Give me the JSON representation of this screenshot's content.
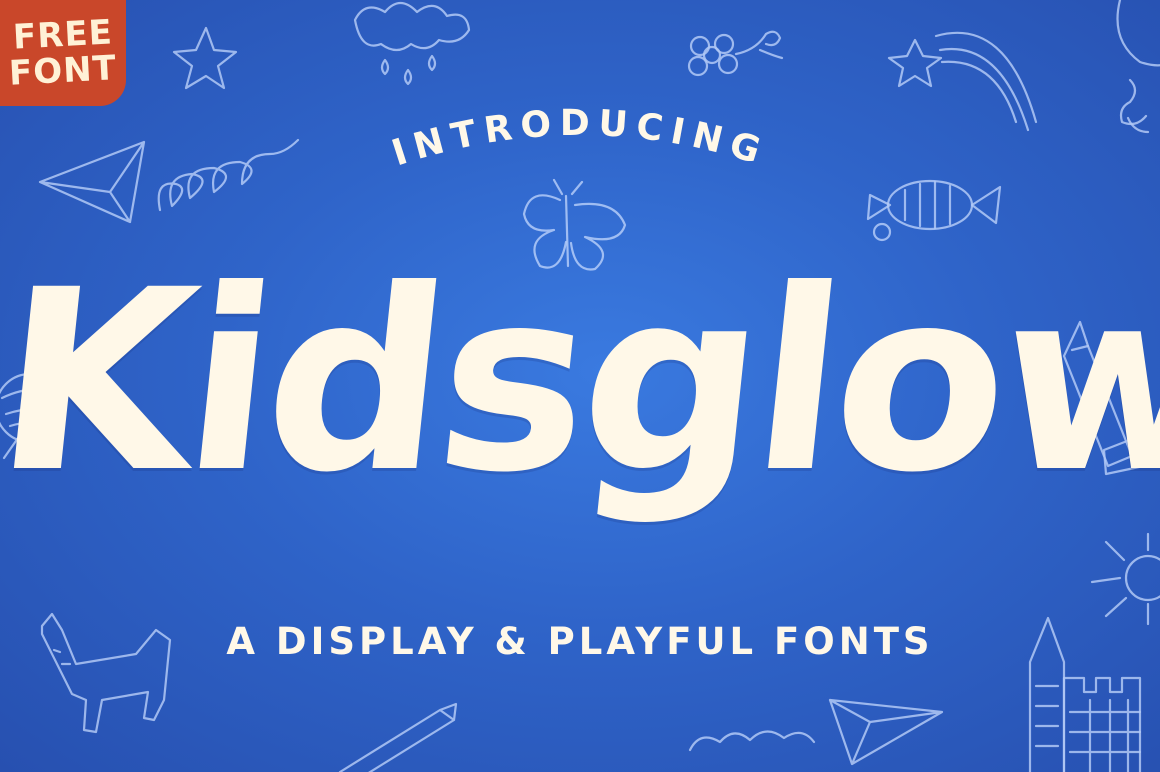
{
  "badge": {
    "line1": "FREE",
    "line2": "FONT"
  },
  "intro": "INTRODUCING",
  "headline": "Kidsglow",
  "tagline": "A DISPLAY & PLAYFUL FONTS",
  "colors": {
    "background": "#2f64c9",
    "badge": "#c9472a",
    "text": "#fff8e8",
    "doodle": "#c9dcff"
  },
  "doodles": [
    "cloud-doodle-icon",
    "star-doodle-icon",
    "flower-doodle-icon",
    "shooting-star-doodle-icon",
    "balloon-doodle-icon",
    "paper-plane-doodle-icon",
    "loops-doodle-icon",
    "butterfly-doodle-icon",
    "fish-doodle-icon",
    "ball-doodle-icon",
    "pencil-doodle-icon",
    "sun-doodle-icon",
    "dog-doodle-icon",
    "castle-doodle-icon",
    "caterpillar-doodle-icon"
  ]
}
